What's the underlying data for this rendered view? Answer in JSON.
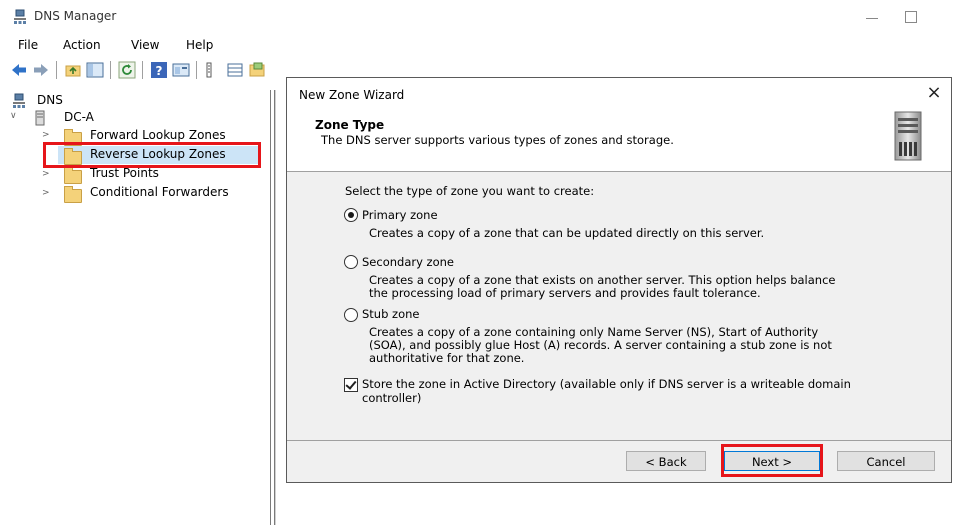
{
  "window": {
    "title": "DNS Manager"
  },
  "menu": [
    "File",
    "Action",
    "View",
    "Help"
  ],
  "toolbar": {
    "icons": [
      "back-arrow-icon",
      "forward-arrow-icon",
      "up-folder-icon",
      "show-hide-console-tree-icon",
      "refresh-icon",
      "help-icon",
      "properties-icon",
      "list-view-icon",
      "detail-view-icon",
      "filter-icon"
    ]
  },
  "tree": {
    "root": "DNS",
    "server": "DC-A",
    "children": [
      "Forward Lookup Zones",
      "Reverse Lookup Zones",
      "Trust Points",
      "Conditional Forwarders"
    ]
  },
  "dialog": {
    "title": "New Zone Wizard",
    "close": "×",
    "header_title": "Zone Type",
    "header_subtitle": "The DNS server supports various types of zones and storage.",
    "prompt": "Select the type of zone you want to create:",
    "options": [
      {
        "label": "Primary zone",
        "desc": [
          "Creates a copy of a zone that can be updated directly on this server."
        ],
        "selected": true
      },
      {
        "label": "Secondary zone",
        "desc": [
          "Creates a copy of a zone that exists on another server. This option helps balance",
          "the processing load of primary servers and provides fault tolerance."
        ],
        "selected": false
      },
      {
        "label": "Stub zone",
        "desc": [
          "Creates a copy of a zone containing only Name Server (NS), Start of Authority",
          "(SOA), and possibly glue Host (A) records. A server containing a stub zone is not",
          "authoritative for that zone."
        ],
        "selected": false
      }
    ],
    "store_ad": {
      "lines": [
        "Store the zone in Active Directory (available only if DNS server is a writeable domain",
        "controller)"
      ],
      "checked": true
    },
    "buttons": {
      "back": "< Back",
      "next": "Next >",
      "cancel": "Cancel"
    }
  },
  "colors": {
    "highlight": "#e6151a",
    "dialog_body": "#f0f0f0"
  }
}
